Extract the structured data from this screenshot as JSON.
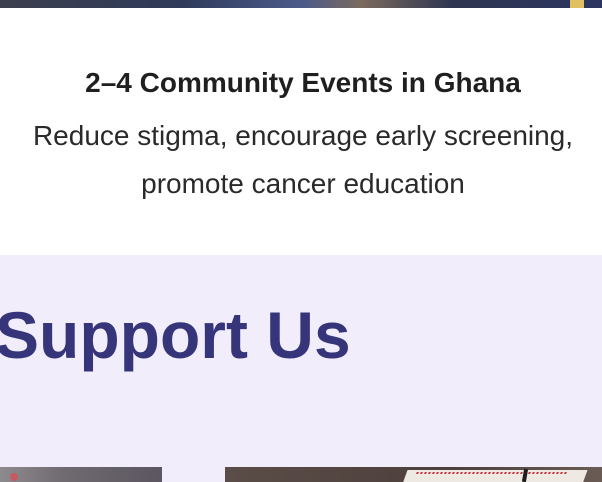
{
  "event": {
    "title": "2–4 Community Events in Ghana",
    "description": "Reduce stigma, encourage early screening, promote cancer education"
  },
  "support": {
    "heading": "Support Us"
  },
  "colors": {
    "heading": "#36357a",
    "section_background": "#f1edfb",
    "text": "#1f1f1f"
  }
}
